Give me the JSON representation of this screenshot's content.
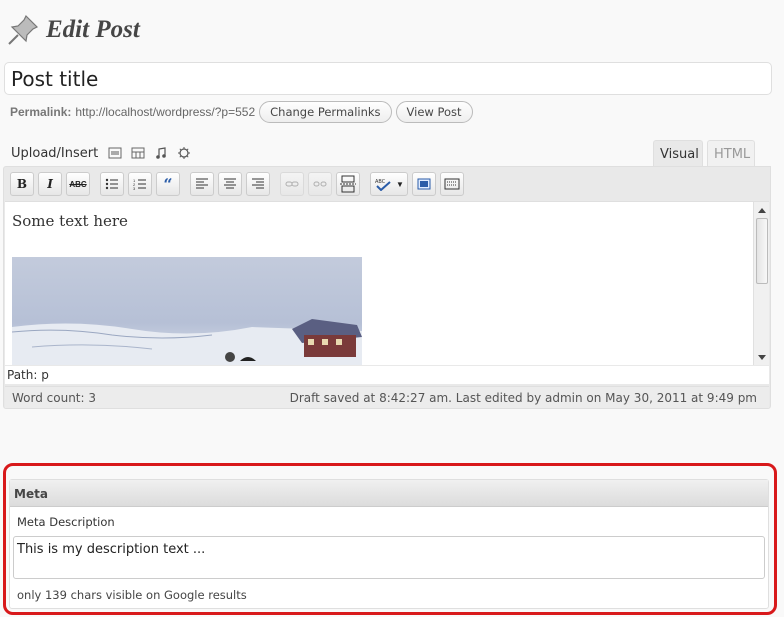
{
  "header": {
    "title": "Edit Post",
    "icon": "pushpin-icon"
  },
  "title_field": {
    "value": "Post title"
  },
  "permalink": {
    "label": "Permalink:",
    "url": "http://localhost/wordpress/?p=552",
    "change_button": "Change Permalinks",
    "view_button": "View Post"
  },
  "upload": {
    "label": "Upload/Insert",
    "icons": [
      "add-image-icon",
      "add-video-icon",
      "add-audio-icon",
      "add-media-icon"
    ]
  },
  "tabs": {
    "visual": "Visual",
    "html": "HTML"
  },
  "toolbar": {
    "buttons": [
      {
        "name": "bold-button",
        "glyph": "B"
      },
      {
        "name": "italic-button",
        "glyph": "I"
      },
      {
        "name": "strikethrough-button",
        "glyph": "ABC"
      },
      {
        "name": "bullet-list-button",
        "glyph": "•≡"
      },
      {
        "name": "numbered-list-button",
        "glyph": "1≡"
      },
      {
        "name": "blockquote-button",
        "glyph": "“"
      },
      {
        "name": "align-left-button",
        "glyph": "≡"
      },
      {
        "name": "align-center-button",
        "glyph": "≡"
      },
      {
        "name": "align-right-button",
        "glyph": "≡"
      },
      {
        "name": "insert-link-button",
        "glyph": "⛓"
      },
      {
        "name": "unlink-button",
        "glyph": "⛓"
      },
      {
        "name": "insert-more-button",
        "glyph": "▭"
      },
      {
        "name": "spellcheck-button",
        "glyph": "✓"
      },
      {
        "name": "fullscreen-button",
        "glyph": "▢"
      },
      {
        "name": "kitchen-sink-button",
        "glyph": "▦"
      }
    ]
  },
  "editor": {
    "content_text": "Some text here",
    "image_alt": "landscape-painting"
  },
  "path_bar": {
    "label": "Path: p"
  },
  "status": {
    "word_count": "Word count: 3",
    "draft_info": "Draft saved at 8:42:27 am. Last edited by admin on May 30, 2011 at 9:49 pm"
  },
  "meta_box": {
    "title": "Meta",
    "field_label": "Meta Description",
    "field_value": "This is my description text ...",
    "hint": "only 139 chars visible on Google results"
  },
  "colors": {
    "highlight": "#d8191b",
    "background": "#f9f9f9"
  }
}
